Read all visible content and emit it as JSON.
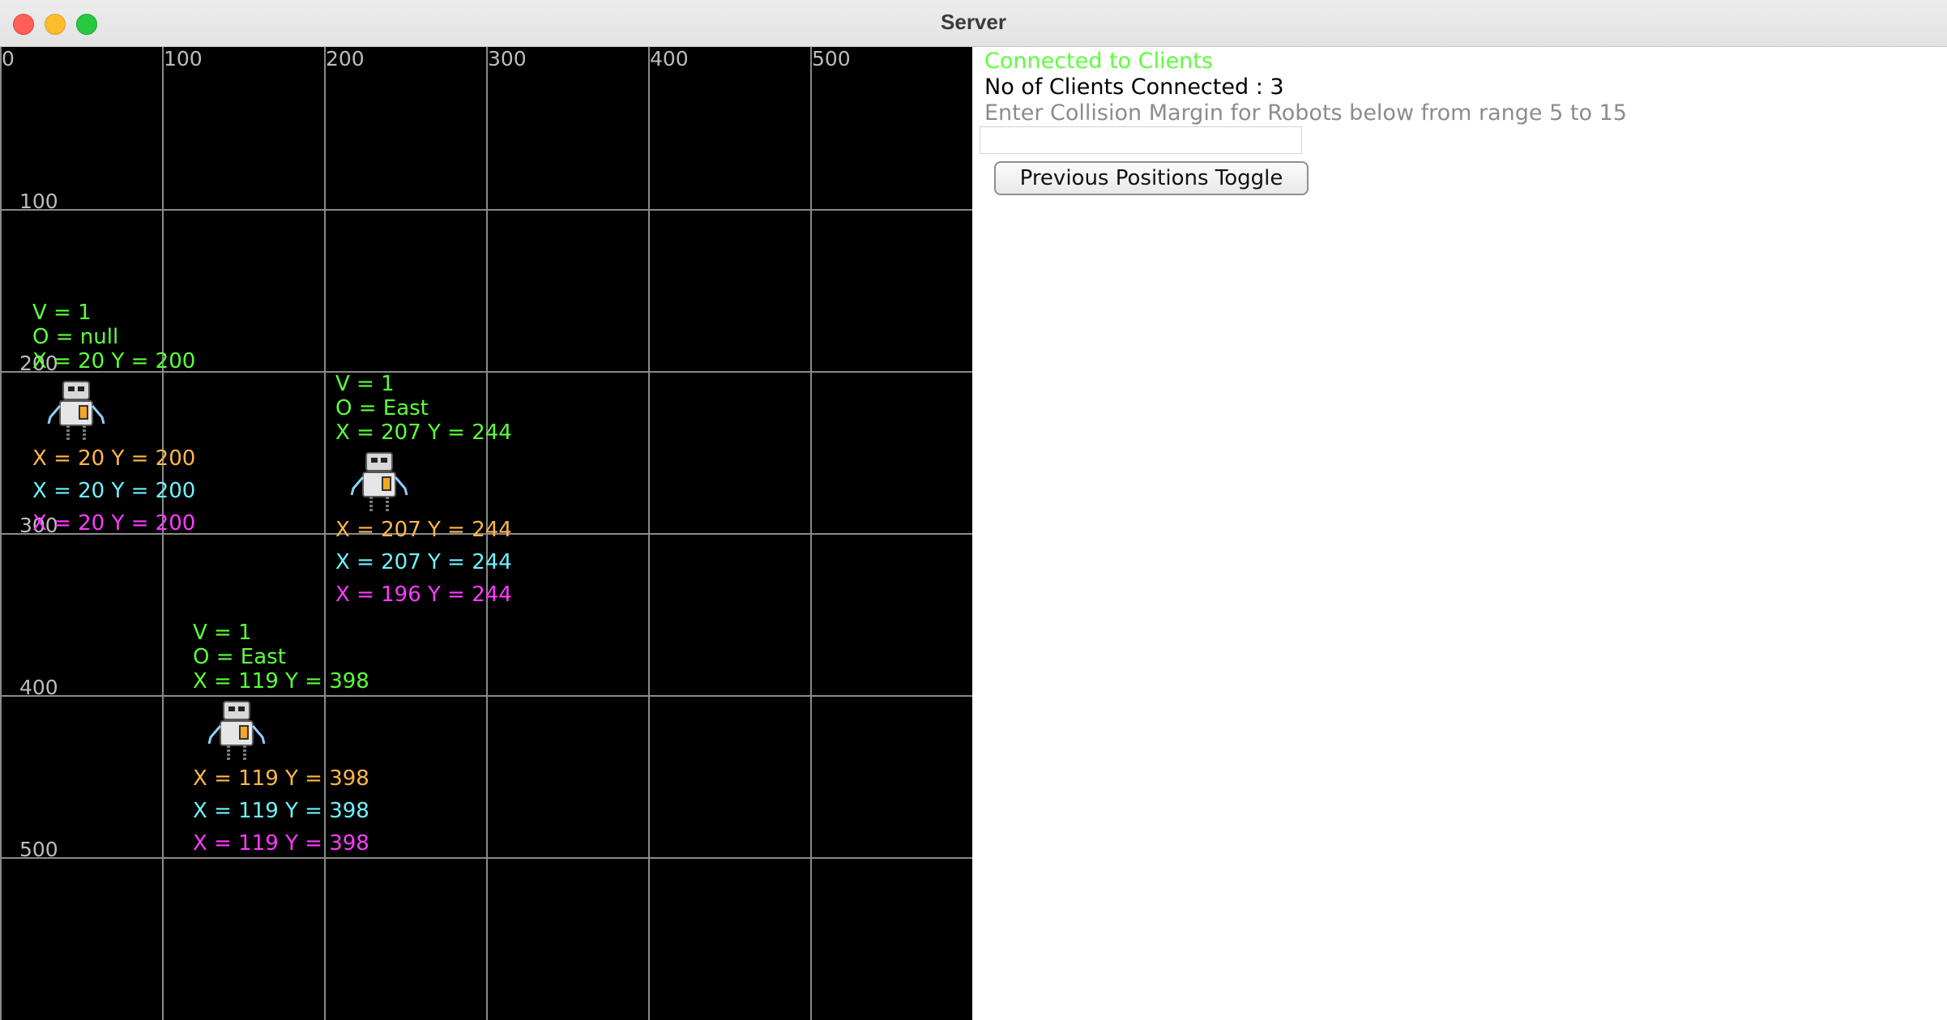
{
  "window": {
    "title": "Server"
  },
  "canvas": {
    "x_ticks": [
      "0",
      "100",
      "200",
      "300",
      "400",
      "500"
    ],
    "y_ticks": [
      "100",
      "200",
      "300",
      "400",
      "500"
    ],
    "robots": [
      {
        "v": "V = 1",
        "o": "O = null",
        "pos": "X = 20 Y = 200",
        "history": [
          "X = 20 Y = 200",
          "X = 20 Y = 200",
          "X = 20 Y = 200"
        ]
      },
      {
        "v": "V = 1",
        "o": "O = East",
        "pos": "X = 207 Y = 244",
        "history": [
          "X = 207 Y = 244",
          "X = 207 Y = 244",
          "X = 196 Y = 244"
        ]
      },
      {
        "v": "V = 1",
        "o": "O = East",
        "pos": "X = 119 Y = 398",
        "history": [
          "X = 119 Y = 398",
          "X = 119 Y = 398",
          "X = 119 Y = 398"
        ]
      }
    ],
    "history_colors": [
      "#ffb84a",
      "#6ff2ff",
      "#ff3cff"
    ],
    "label_color": "#5dff3c"
  },
  "panel": {
    "status": "Connected to Clients",
    "clients": "No of Clients Connected : 3",
    "prompt": "Enter Collision Margin for Robots below from range 5 to 15",
    "margin_value": "",
    "toggle_label": "Previous Positions Toggle"
  }
}
